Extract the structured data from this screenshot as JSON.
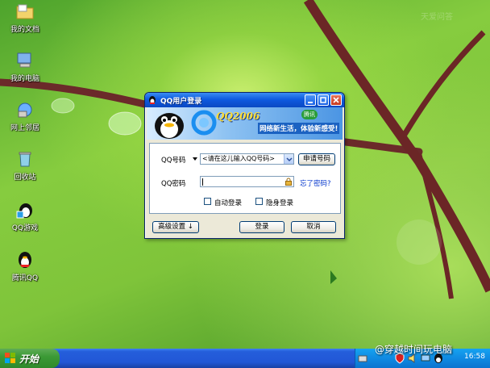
{
  "desktop": {
    "icons": [
      {
        "label": "我的文档",
        "icon": "folder-icon"
      },
      {
        "label": "我的电脑",
        "icon": "computer-icon"
      },
      {
        "label": "网上邻居",
        "icon": "network-icon"
      },
      {
        "label": "回收站",
        "icon": "recycle-bin-icon"
      },
      {
        "label": "QQ游戏",
        "icon": "qq-game-icon"
      },
      {
        "label": "腾讯QQ",
        "icon": "qq-penguin-icon"
      }
    ],
    "faint_watermark": "天爱问答"
  },
  "login_window": {
    "title": "QQ用户登录",
    "banner": {
      "logo_text": "QQ2006",
      "slogan": "网络新生活，体验新感受!",
      "badge": "腾讯"
    },
    "qq_number_label": "QQ号码",
    "qq_number_placeholder": "<请在这儿输入QQ号码>",
    "apply_button": "申请号码",
    "password_label": "QQ密码",
    "forgot_link": "忘了密码?",
    "auto_login_label": "自动登录",
    "invisible_login_label": "隐身登录",
    "advanced_button": "高级设置 ↓",
    "login_button": "登录",
    "cancel_button": "取消"
  },
  "taskbar": {
    "start_label": "开始",
    "clock": "16:58",
    "watermark": "@穿越时间玩电脑"
  },
  "colors": {
    "titlebar": "#0f5be0",
    "window_bg": "#ece9d8",
    "start_green": "#3c9a36",
    "taskbar_blue": "#245edb",
    "link_blue": "#0033cc"
  }
}
